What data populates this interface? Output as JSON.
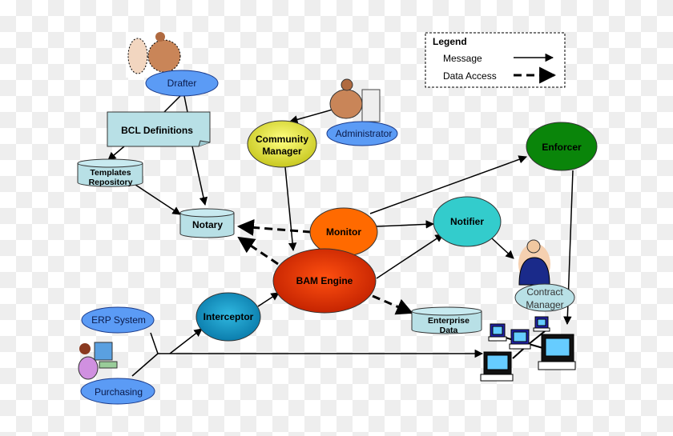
{
  "legend": {
    "title": "Legend",
    "items": [
      {
        "label": "Message",
        "style": "solid-arrow"
      },
      {
        "label": "Data Access",
        "style": "dashed-arrow"
      }
    ]
  },
  "nodes": {
    "drafter": "Drafter",
    "bcl": "BCL Definitions",
    "templates": [
      "Templates",
      "Repository"
    ],
    "notary": "Notary",
    "community": [
      "Community",
      "Manager"
    ],
    "administrator": "Administrator",
    "enforcer": "Enforcer",
    "monitor": "Monitor",
    "notifier": "Notifier",
    "bam": "BAM Engine",
    "interceptor": "Interceptor",
    "enterprise": [
      "Enterprise",
      "Data"
    ],
    "erp": "ERP System",
    "purchasing": "Purchasing",
    "contract": [
      "Contract",
      "Manager"
    ]
  },
  "colors": {
    "person": "#5b9bf5",
    "store": "#b8e0e6",
    "community": "#dede40",
    "enforcer": "#0a850a",
    "monitor": "#ff6a00",
    "notifier": "#33cccc",
    "bam": "#e2380c",
    "interceptor": "#1a9cc8"
  }
}
